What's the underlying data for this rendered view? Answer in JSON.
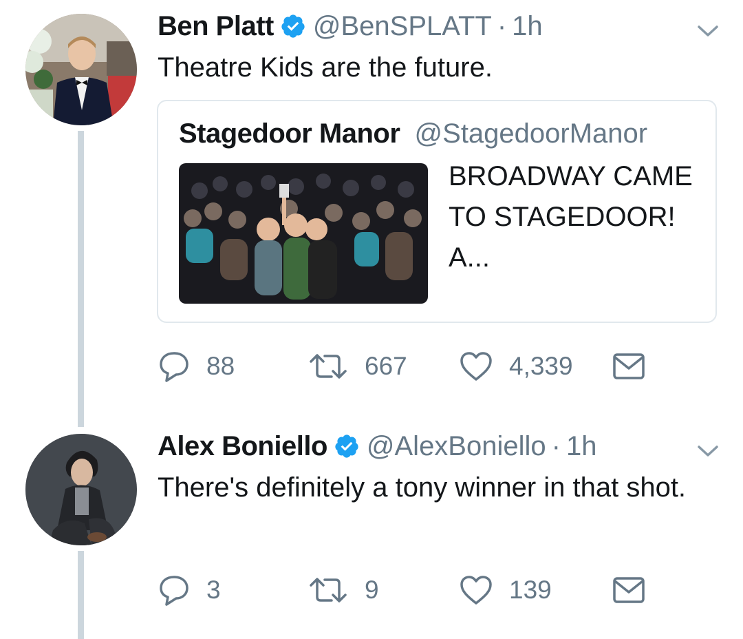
{
  "tweets": [
    {
      "author": {
        "name": "Ben Platt",
        "handle": "@BenSPLATT",
        "verified": true
      },
      "separator": "·",
      "time": "1h",
      "text": "Theatre Kids are the future.",
      "quoted": {
        "name": "Stagedoor Manor",
        "handle": "@StagedoorManor",
        "text": "BROADWAY CAME TO STAGEDOOR! A..."
      },
      "actions": {
        "replies": "88",
        "retweets": "667",
        "likes": "4,339"
      }
    },
    {
      "author": {
        "name": "Alex Boniello",
        "handle": "@AlexBoniello",
        "verified": true
      },
      "separator": "·",
      "time": "1h",
      "text": "There's definitely a tony winner in that shot.",
      "actions": {
        "replies": "3",
        "retweets": "9",
        "likes": "139"
      }
    }
  ],
  "colors": {
    "verified_badge": "#1da1f2",
    "secondary_text": "#657786",
    "thread_line": "#ccd6dd",
    "card_border": "#e1e8ed"
  },
  "icons": {
    "reply": "reply-bubble-icon",
    "retweet": "retweet-arrows-icon",
    "like": "heart-outline-icon",
    "dm": "envelope-icon",
    "menu": "chevron-down-icon",
    "verified": "verified-check-icon"
  }
}
